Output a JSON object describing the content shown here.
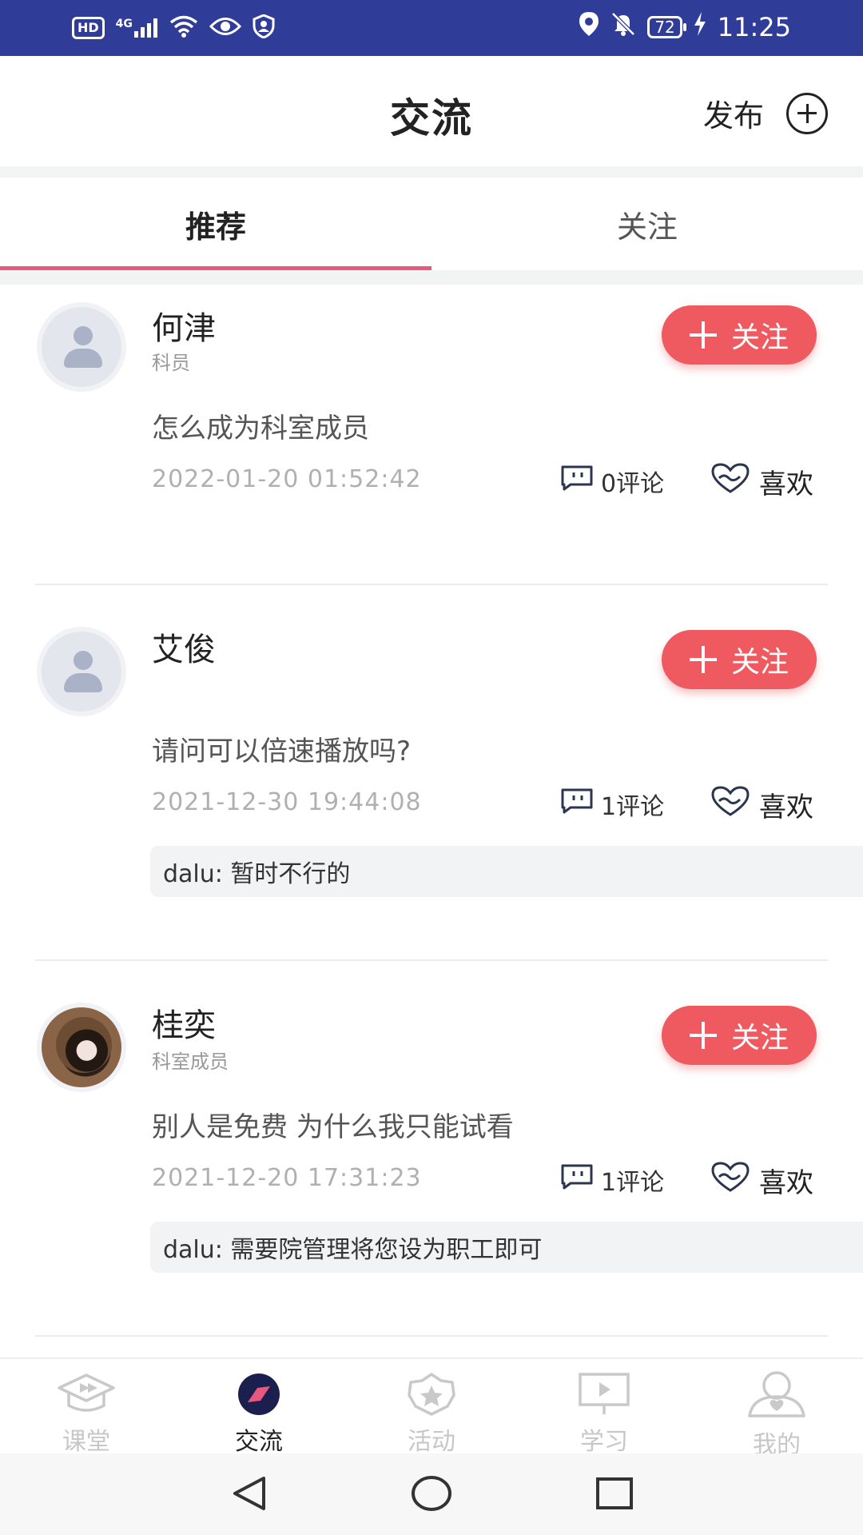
{
  "status_bar": {
    "hd": "HD",
    "signal": "4G",
    "battery": "72",
    "time": "11:25"
  },
  "header": {
    "title": "交流",
    "publish_label": "发布"
  },
  "tabs": [
    {
      "label": "推荐",
      "active": true
    },
    {
      "label": "关注",
      "active": false
    }
  ],
  "follow_label": "关注",
  "posts": [
    {
      "username": "何津",
      "role": "科员",
      "content": "怎么成为科室成员",
      "time": "2022-01-20 01:52:42",
      "comments": "0评论",
      "likes": "喜欢"
    },
    {
      "username": "艾俊",
      "role": "",
      "content": "请问可以倍速播放吗?",
      "time": "2021-12-30 19:44:08",
      "comments": "1评论",
      "likes": "喜欢",
      "reply": "dalu: 暂时不行的"
    },
    {
      "username": "桂奕",
      "role": "科室成员",
      "content": "别人是免费 为什么我只能试看",
      "time": "2021-12-20 17:31:23",
      "comments": "1评论",
      "likes": "喜欢",
      "reply": "dalu: 需要院管理将您设为职工即可"
    }
  ],
  "bottom_nav": [
    {
      "label": "课堂",
      "icon": "classroom-icon",
      "active": false
    },
    {
      "label": "交流",
      "icon": "compass-icon",
      "active": true
    },
    {
      "label": "活动",
      "icon": "star-badge-icon",
      "active": false
    },
    {
      "label": "学习",
      "icon": "presentation-play-icon",
      "active": false
    },
    {
      "label": "我的",
      "icon": "user-heart-icon",
      "active": false
    }
  ],
  "colors": {
    "status_bar": "#2f3d99",
    "accent": "#e8577e",
    "follow_button": "#ee5a5f",
    "active_nav_icon": "#1b1f4d"
  }
}
